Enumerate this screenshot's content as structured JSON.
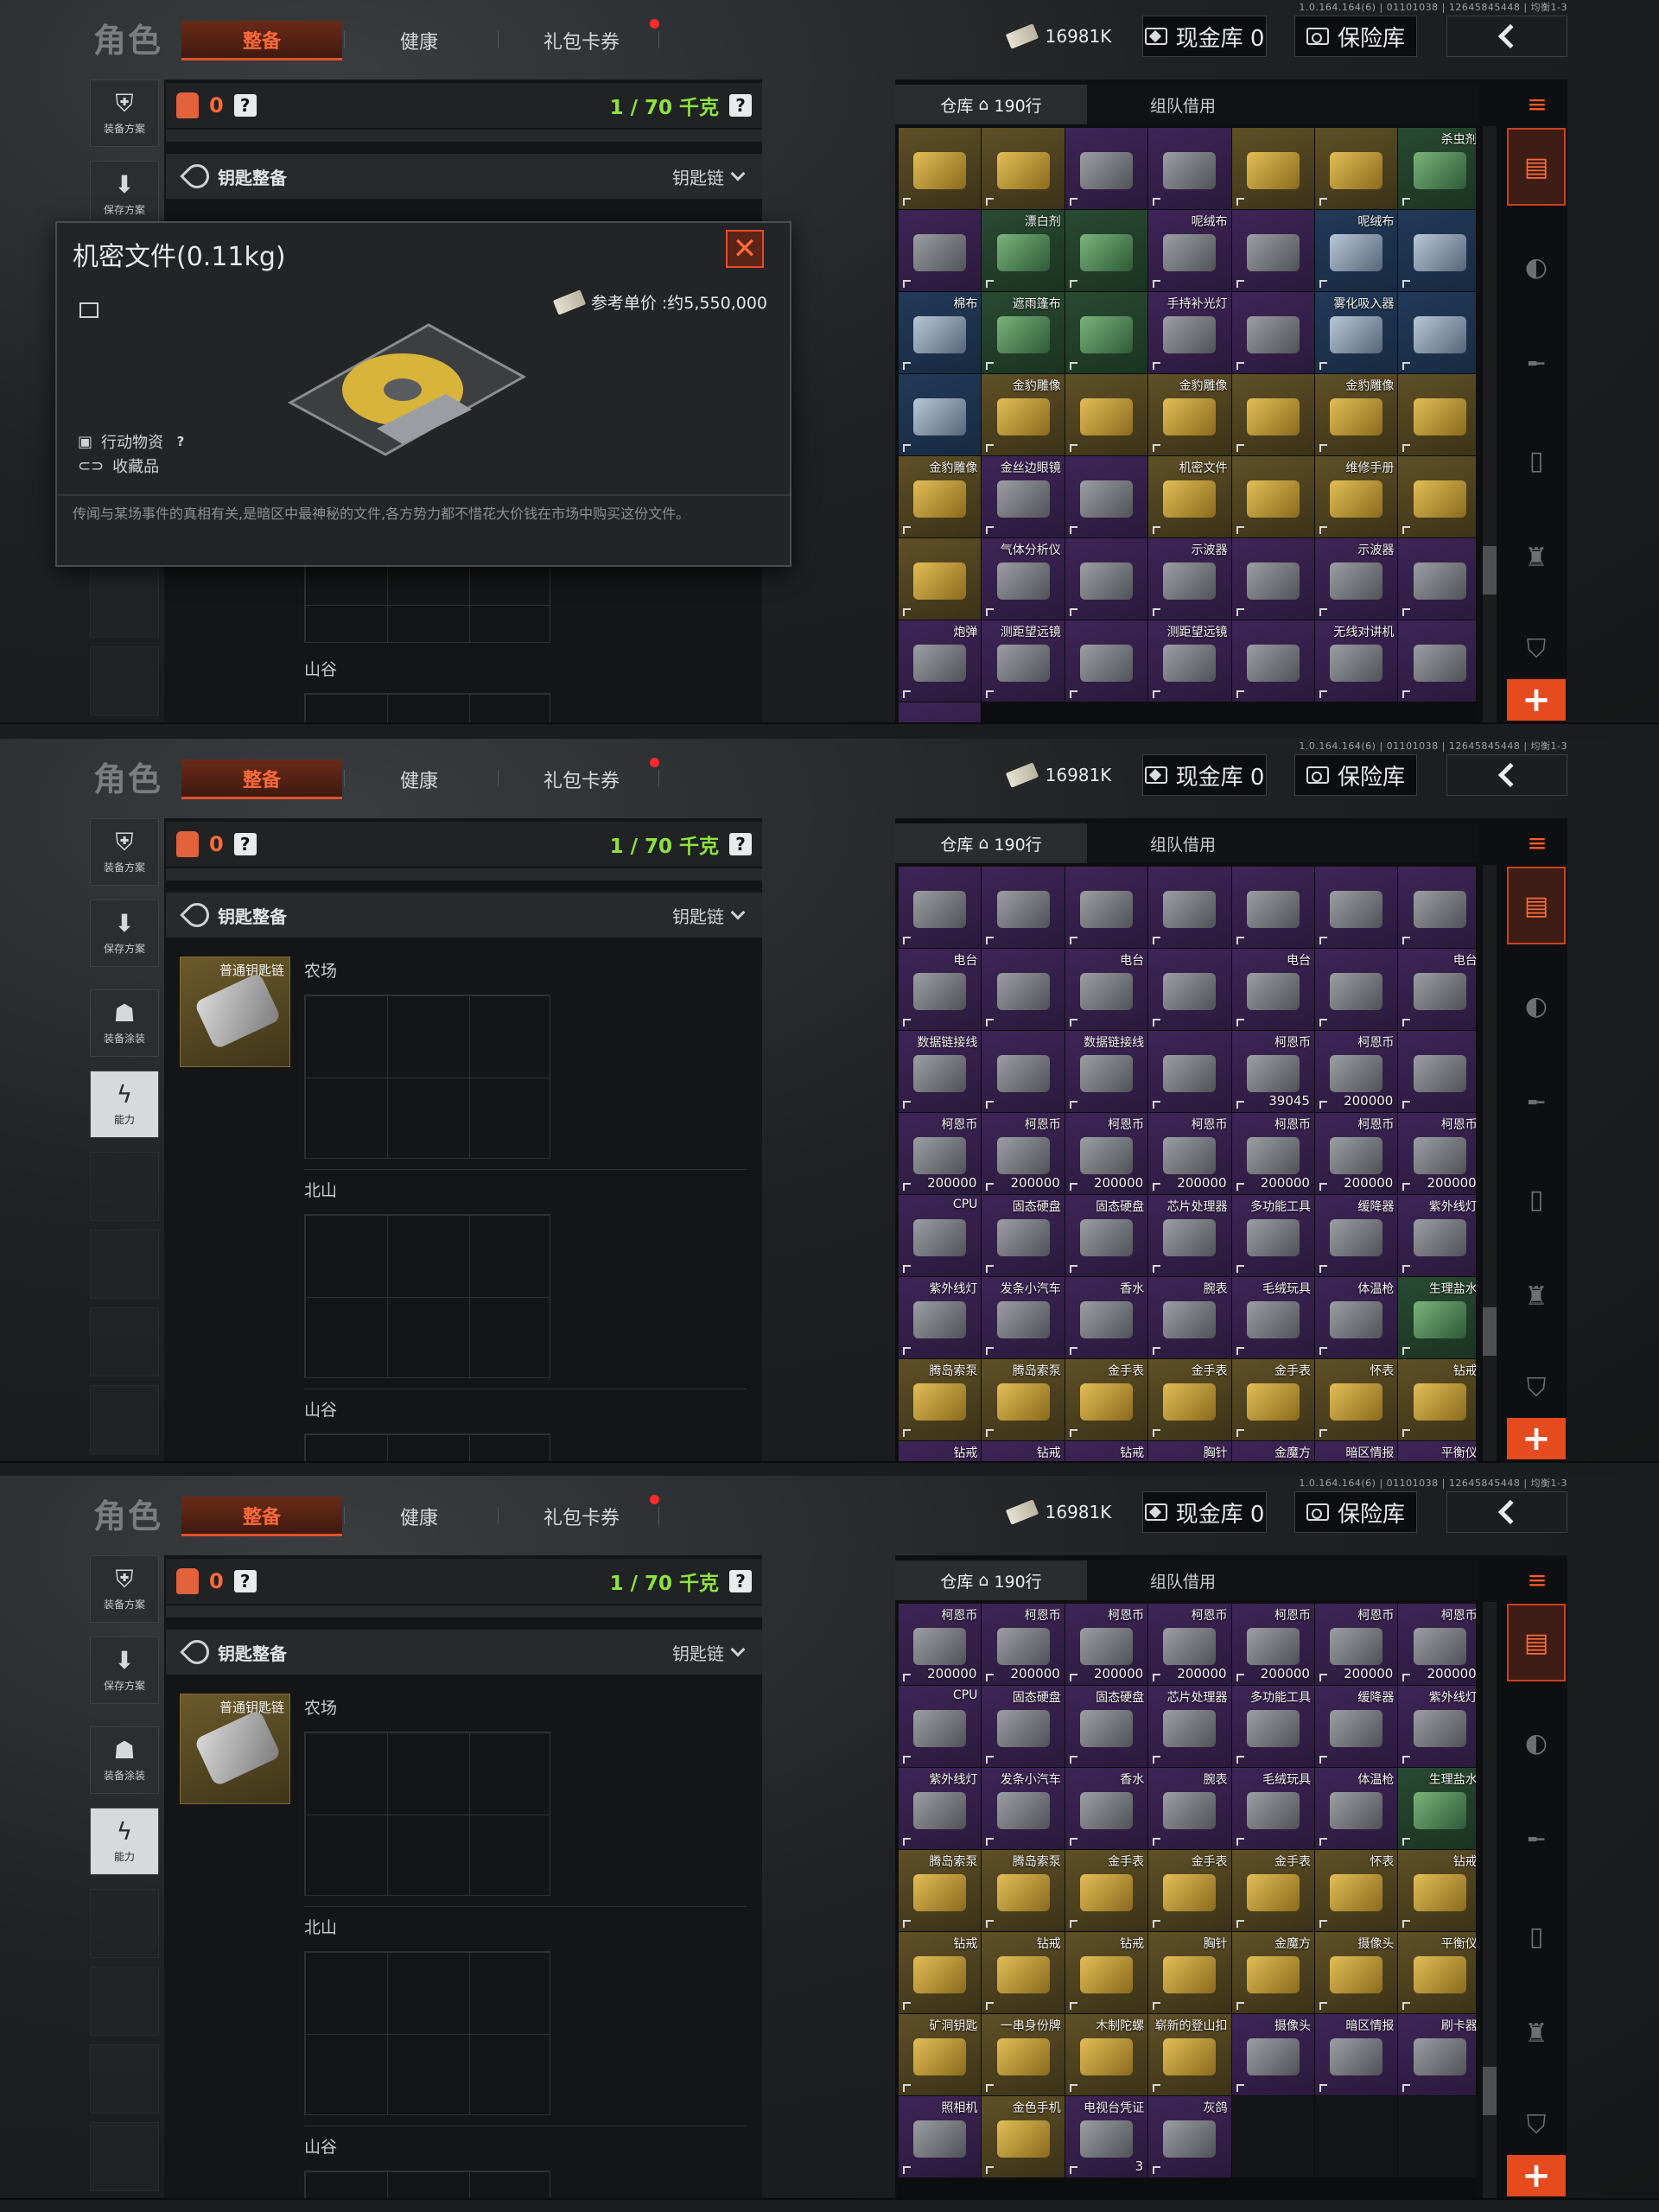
{
  "version": "1.0.164.164(6) | 01101038 | 12645845448 | 均衡1-3",
  "title": "角色",
  "tabs": {
    "equip": "整备",
    "health": "健康",
    "gift": "礼包卡券"
  },
  "currency": {
    "money": "16981K",
    "cash_vault": "现金库 0",
    "safe": "保险库"
  },
  "left_buttons": {
    "plan": "装备方案",
    "save": "保存方案",
    "skin": "装备涂装",
    "ability": "能力"
  },
  "bag": {
    "count": "0",
    "weight": "1 / 70 千克",
    "help": "?"
  },
  "keychain": {
    "label": "钥匙整备",
    "selector": "钥匙链",
    "item_name": "普通钥匙链"
  },
  "key_areas": {
    "a": "农场",
    "b": "北山",
    "c": "山谷"
  },
  "popup": {
    "title": "机密文件(0.11kg)",
    "price": "参考单价 :约5,550,000",
    "tag1": "行动物资",
    "tag2": "收藏品",
    "desc": "传闻与某场事件的真相有关,是暗区中最神秘的文件,各方势力都不惜花大价钱在市场中购买这份文件。"
  },
  "warehouse": {
    "tab_warehouse": "仓库",
    "rows": "190行",
    "tab_team": "组队借用"
  },
  "colors": {
    "accent": "#e64a1f",
    "weight_green": "#8de23f",
    "gold": "#5f5026",
    "purple": "#3e2557",
    "blue": "#223a58"
  },
  "grids": [
    [
      {
        "n": "",
        "c": "gold"
      },
      {
        "n": "",
        "c": "gold"
      },
      {
        "n": "",
        "c": "purple"
      },
      {
        "n": "",
        "c": "purple"
      },
      {
        "n": "",
        "c": "gold"
      },
      {
        "n": "",
        "c": "gold"
      },
      {
        "n": "杀虫剂",
        "c": "green"
      },
      {
        "n": "",
        "c": "purple"
      },
      {
        "n": "漂白剂",
        "c": "green"
      },
      {
        "n": "",
        "c": "green"
      },
      {
        "n": "呢绒布",
        "c": "purple"
      },
      {
        "n": "",
        "c": "purple"
      },
      {
        "n": "呢绒布",
        "c": "blue"
      },
      {
        "n": "",
        "c": "blue"
      },
      {
        "n": "棉布",
        "c": "blue"
      },
      {
        "n": "遮雨篷布",
        "c": "green"
      },
      {
        "n": "",
        "c": "green"
      },
      {
        "n": "手持补光灯",
        "c": "purple"
      },
      {
        "n": "",
        "c": "purple"
      },
      {
        "n": "雾化吸入器",
        "c": "blue"
      },
      {
        "n": "",
        "c": "blue"
      },
      {
        "n": "",
        "c": "blue"
      },
      {
        "n": "金豹雕像",
        "c": "gold"
      },
      {
        "n": "",
        "c": "gold"
      },
      {
        "n": "金豹雕像",
        "c": "gold"
      },
      {
        "n": "",
        "c": "gold"
      },
      {
        "n": "金豹雕像",
        "c": "gold"
      },
      {
        "n": "",
        "c": "gold"
      },
      {
        "n": "金豹雕像",
        "c": "gold"
      },
      {
        "n": "金丝边眼镜",
        "c": "purple"
      },
      {
        "n": "",
        "c": "purple"
      },
      {
        "n": "机密文件",
        "c": "gold"
      },
      {
        "n": "",
        "c": "gold"
      },
      {
        "n": "维修手册",
        "c": "gold"
      },
      {
        "n": "",
        "c": "gold"
      },
      {
        "n": "",
        "c": "gold"
      },
      {
        "n": "气体分析仪",
        "c": "purple"
      },
      {
        "n": "",
        "c": "purple"
      },
      {
        "n": "示波器",
        "c": "purple"
      },
      {
        "n": "",
        "c": "purple"
      },
      {
        "n": "示波器",
        "c": "purple"
      },
      {
        "n": "",
        "c": "purple"
      },
      {
        "n": "炮弹",
        "c": "purple"
      },
      {
        "n": "测距望远镜",
        "c": "purple"
      },
      {
        "n": "",
        "c": "purple"
      },
      {
        "n": "测距望远镜",
        "c": "purple"
      },
      {
        "n": "",
        "c": "purple"
      },
      {
        "n": "无线对讲机",
        "c": "purple"
      },
      {
        "n": "",
        "c": "purple"
      },
      {
        "n": "",
        "c": "purple"
      }
    ],
    [
      {
        "n": "",
        "c": "purple"
      },
      {
        "n": "",
        "c": "purple"
      },
      {
        "n": "",
        "c": "purple"
      },
      {
        "n": "",
        "c": "purple"
      },
      {
        "n": "",
        "c": "purple"
      },
      {
        "n": "",
        "c": "purple"
      },
      {
        "n": "",
        "c": "purple"
      },
      {
        "n": "电台",
        "c": "purple"
      },
      {
        "n": "",
        "c": "purple"
      },
      {
        "n": "电台",
        "c": "purple"
      },
      {
        "n": "",
        "c": "purple"
      },
      {
        "n": "电台",
        "c": "purple"
      },
      {
        "n": "",
        "c": "purple"
      },
      {
        "n": "电台",
        "c": "purple"
      },
      {
        "n": "数据链接线",
        "c": "purple"
      },
      {
        "n": "",
        "c": "purple"
      },
      {
        "n": "数据链接线",
        "c": "purple"
      },
      {
        "n": "",
        "c": "purple"
      },
      {
        "n": "柯恩币",
        "c": "purple",
        "q": "39045"
      },
      {
        "n": "柯恩币",
        "c": "purple",
        "q": "200000"
      },
      {
        "n": "",
        "c": "purple"
      },
      {
        "n": "柯恩币",
        "c": "purple",
        "q": "200000"
      },
      {
        "n": "柯恩币",
        "c": "purple",
        "q": "200000"
      },
      {
        "n": "柯恩币",
        "c": "purple",
        "q": "200000"
      },
      {
        "n": "柯恩币",
        "c": "purple",
        "q": "200000"
      },
      {
        "n": "柯恩币",
        "c": "purple",
        "q": "200000"
      },
      {
        "n": "柯恩币",
        "c": "purple",
        "q": "200000"
      },
      {
        "n": "柯恩币",
        "c": "purple",
        "q": "200000"
      },
      {
        "n": "CPU",
        "c": "purple"
      },
      {
        "n": "固态硬盘",
        "c": "purple"
      },
      {
        "n": "固态硬盘",
        "c": "purple"
      },
      {
        "n": "芯片处理器",
        "c": "purple"
      },
      {
        "n": "多功能工具",
        "c": "purple"
      },
      {
        "n": "缓降器",
        "c": "purple"
      },
      {
        "n": "紫外线灯",
        "c": "purple"
      },
      {
        "n": "紫外线灯",
        "c": "purple"
      },
      {
        "n": "发条小汽车",
        "c": "purple"
      },
      {
        "n": "香水",
        "c": "purple"
      },
      {
        "n": "腕表",
        "c": "purple"
      },
      {
        "n": "毛绒玩具",
        "c": "purple"
      },
      {
        "n": "体温枪",
        "c": "purple"
      },
      {
        "n": "生理盐水",
        "c": "green"
      },
      {
        "n": "腾岛索泵",
        "c": "gold"
      },
      {
        "n": "腾岛索泵",
        "c": "gold"
      },
      {
        "n": "金手表",
        "c": "gold"
      },
      {
        "n": "金手表",
        "c": "gold"
      },
      {
        "n": "金手表",
        "c": "gold"
      },
      {
        "n": "怀表",
        "c": "gold"
      },
      {
        "n": "钻戒",
        "c": "gold"
      },
      {
        "n": "钻戒",
        "c": "purple"
      },
      {
        "n": "钻戒",
        "c": "purple"
      },
      {
        "n": "钻戒",
        "c": "purple"
      },
      {
        "n": "胸针",
        "c": "purple"
      },
      {
        "n": "金魔方",
        "c": "purple"
      },
      {
        "n": "暗区情报",
        "c": "purple"
      },
      {
        "n": "平衡仪",
        "c": "purple"
      }
    ],
    [
      {
        "n": "柯恩币",
        "c": "purple",
        "q": "200000"
      },
      {
        "n": "柯恩币",
        "c": "purple",
        "q": "200000"
      },
      {
        "n": "柯恩币",
        "c": "purple",
        "q": "200000"
      },
      {
        "n": "柯恩币",
        "c": "purple",
        "q": "200000"
      },
      {
        "n": "柯恩币",
        "c": "purple",
        "q": "200000"
      },
      {
        "n": "柯恩币",
        "c": "purple",
        "q": "200000"
      },
      {
        "n": "柯恩币",
        "c": "purple",
        "q": "200000"
      },
      {
        "n": "CPU",
        "c": "purple"
      },
      {
        "n": "固态硬盘",
        "c": "purple"
      },
      {
        "n": "固态硬盘",
        "c": "purple"
      },
      {
        "n": "芯片处理器",
        "c": "purple"
      },
      {
        "n": "多功能工具",
        "c": "purple"
      },
      {
        "n": "缓降器",
        "c": "purple"
      },
      {
        "n": "紫外线灯",
        "c": "purple"
      },
      {
        "n": "紫外线灯",
        "c": "purple"
      },
      {
        "n": "发条小汽车",
        "c": "purple"
      },
      {
        "n": "香水",
        "c": "purple"
      },
      {
        "n": "腕表",
        "c": "purple"
      },
      {
        "n": "毛绒玩具",
        "c": "purple"
      },
      {
        "n": "体温枪",
        "c": "purple"
      },
      {
        "n": "生理盐水",
        "c": "green"
      },
      {
        "n": "腾岛索泵",
        "c": "gold"
      },
      {
        "n": "腾岛索泵",
        "c": "gold"
      },
      {
        "n": "金手表",
        "c": "gold"
      },
      {
        "n": "金手表",
        "c": "gold"
      },
      {
        "n": "金手表",
        "c": "gold"
      },
      {
        "n": "怀表",
        "c": "gold"
      },
      {
        "n": "钻戒",
        "c": "gold"
      },
      {
        "n": "钻戒",
        "c": "gold"
      },
      {
        "n": "钻戒",
        "c": "gold"
      },
      {
        "n": "钻戒",
        "c": "gold"
      },
      {
        "n": "胸针",
        "c": "gold"
      },
      {
        "n": "金魔方",
        "c": "gold"
      },
      {
        "n": "摄像头",
        "c": "gold"
      },
      {
        "n": "平衡仪",
        "c": "gold"
      },
      {
        "n": "矿洞钥匙",
        "c": "gold"
      },
      {
        "n": "一串身份牌",
        "c": "gold"
      },
      {
        "n": "木制陀螺",
        "c": "gold"
      },
      {
        "n": "崭新的登山扣",
        "c": "gold"
      },
      {
        "n": "摄像头",
        "c": "purple"
      },
      {
        "n": "暗区情报",
        "c": "purple"
      },
      {
        "n": "刷卡器",
        "c": "purple"
      },
      {
        "n": "照相机",
        "c": "purple"
      },
      {
        "n": "金色手机",
        "c": "gold"
      },
      {
        "n": "电视台凭证",
        "c": "purple",
        "q": "3"
      },
      {
        "n": "灰鸽",
        "c": "purple"
      },
      {
        "n": "",
        "c": "empty"
      },
      {
        "n": "",
        "c": "empty"
      },
      {
        "n": "",
        "c": "empty"
      }
    ]
  ]
}
